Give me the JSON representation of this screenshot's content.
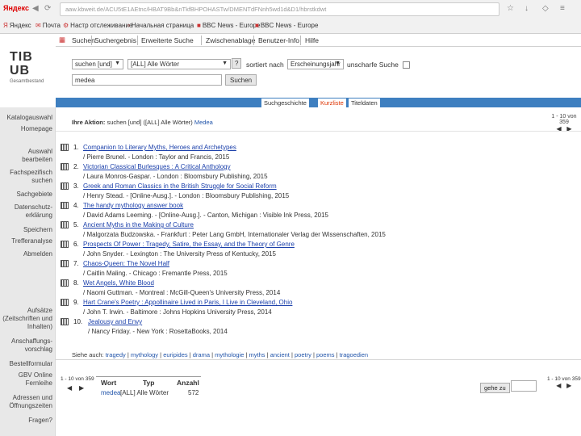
{
  "browser": {
    "brand": "Яндекс",
    "url": "aaw.kbweit.de/ACU5tE1AEtnc/HBAT9Bb&nTkfBHPOHASTw/DMENTdFNnh5wd1d&D1/hbrstkdwt",
    "bookmarks": [
      "Яндекс",
      "Почта",
      "Настр отслеживание",
      "Начальная страница",
      "BBC News - Europe",
      "BBC News - Europe"
    ]
  },
  "topnav": {
    "items": [
      "Suchen",
      "Suchergebnis",
      "Erweiterte Suche",
      "Zwischenablage",
      "Benutzer-Info",
      "Hilfe"
    ]
  },
  "logo": {
    "line1": "TIB",
    "line2": "UB",
    "sub": "Gesamtbestand"
  },
  "search": {
    "mode": "suchen [und]",
    "field": "[ALL] Alle Wörter",
    "help": "?",
    "sort_label": "sortiert nach",
    "sort_value": "Erscheinungsjahr",
    "fuzzy_label": "unscharfe Suche",
    "query": "medea",
    "submit": "Suchen"
  },
  "tabs": [
    "Suchgeschichte",
    "Kurzliste",
    "Titeldaten"
  ],
  "sidebar": {
    "items": [
      "Katalogauswahl",
      "Homepage",
      "Auswahl bearbeiten",
      "Fachspezifisch suchen",
      "Sachgebiete",
      "Datenschutz-erklärung",
      "Speichern",
      "Trefferanalyse",
      "Abmelden",
      "Aufsätze (Zeitschriften und Inhalten)",
      "Anschaffungs-vorschlag",
      "Bestellformular",
      "GBV Online Fernleihe",
      "Adressen und Öffnungszeiten",
      "Fragen?"
    ]
  },
  "results": {
    "action_prefix": "Ihre Aktion:",
    "action_text": "suchen [und] ([ALL] Alle Wörter)",
    "action_link": "Medea",
    "paging": "1 - 10 von 359",
    "records": [
      {
        "num": "1.",
        "title": "Companion to Literary Myths, Heroes and Archetypes",
        "resp": "/ Pierre Brunel. - London : Taylor and Francis, 2015"
      },
      {
        "num": "2.",
        "title": "Victorian Classical Burlesques : A Critical Anthology",
        "resp": "/ Laura Monros-Gaspar. - London : Bloomsbury Publishing, 2015"
      },
      {
        "num": "3.",
        "title": "Greek and Roman Classics in the British Struggle for Social Reform",
        "resp": "/ Henry Stead. - [Online-Ausg.]. - London : Bloomsbury Publishing, 2015"
      },
      {
        "num": "4.",
        "title": "The handy mythology answer book",
        "resp": "/ David Adams Leeming. - [Online-Ausg.]. - Canton, Michigan : Visible Ink Press, 2015"
      },
      {
        "num": "5.",
        "title": "Ancient Myths in the Making of Culture",
        "resp": "/ Malgorzata Budzowska. - Frankfurt : Peter Lang GmbH, Internationaler Verlag der Wissenschaften, 2015"
      },
      {
        "num": "6.",
        "title": "Prospects Of Power : Tragedy, Satire, the Essay, and the Theory of Genre",
        "resp": "/ John Snyder. - Lexington : The University Press of Kentucky, 2015"
      },
      {
        "num": "7.",
        "title": "Chaos-Queen: The Novel Half",
        "resp": "/ Caitlin Maling. - Chicago : Fremantle Press, 2015"
      },
      {
        "num": "8.",
        "title": "Wet Angels, White Blood",
        "resp": "/ Naomi Guttman. - Montreal : McGill-Queen's University Press, 2014"
      },
      {
        "num": "9.",
        "title": "Hart Crane's Poetry : Appollinaire Lived in Paris, I Live in Cleveland, Ohio",
        "resp": "/ John T. Irwin. - Baltimore : Johns Hopkins University Press, 2014"
      },
      {
        "num": "10.",
        "title": "Jealousy and Envy",
        "resp": "/ Nancy Friday. - New York : RosettaBooks, 2014"
      }
    ],
    "see_also_label": "Siehe auch:",
    "see_also": [
      "tragedy",
      "mythology",
      "euripides",
      "drama",
      "mythologie",
      "myths",
      "ancient",
      "poetry",
      "poems",
      "tragoedien"
    ]
  },
  "bottom": {
    "paging": "1 - 10 von 359",
    "col_word": "Wort",
    "col_type": "Typ",
    "col_count": "Anzahl",
    "word": "medea",
    "type": "[ALL] Alle Wörter",
    "count": "572",
    "goto_label": "gehe zu",
    "paging_right": "1 - 10 von 359"
  },
  "colors": {
    "tab_bar": "#3e7fc0",
    "link": "#2255aa",
    "active_tab": "#d30000"
  }
}
